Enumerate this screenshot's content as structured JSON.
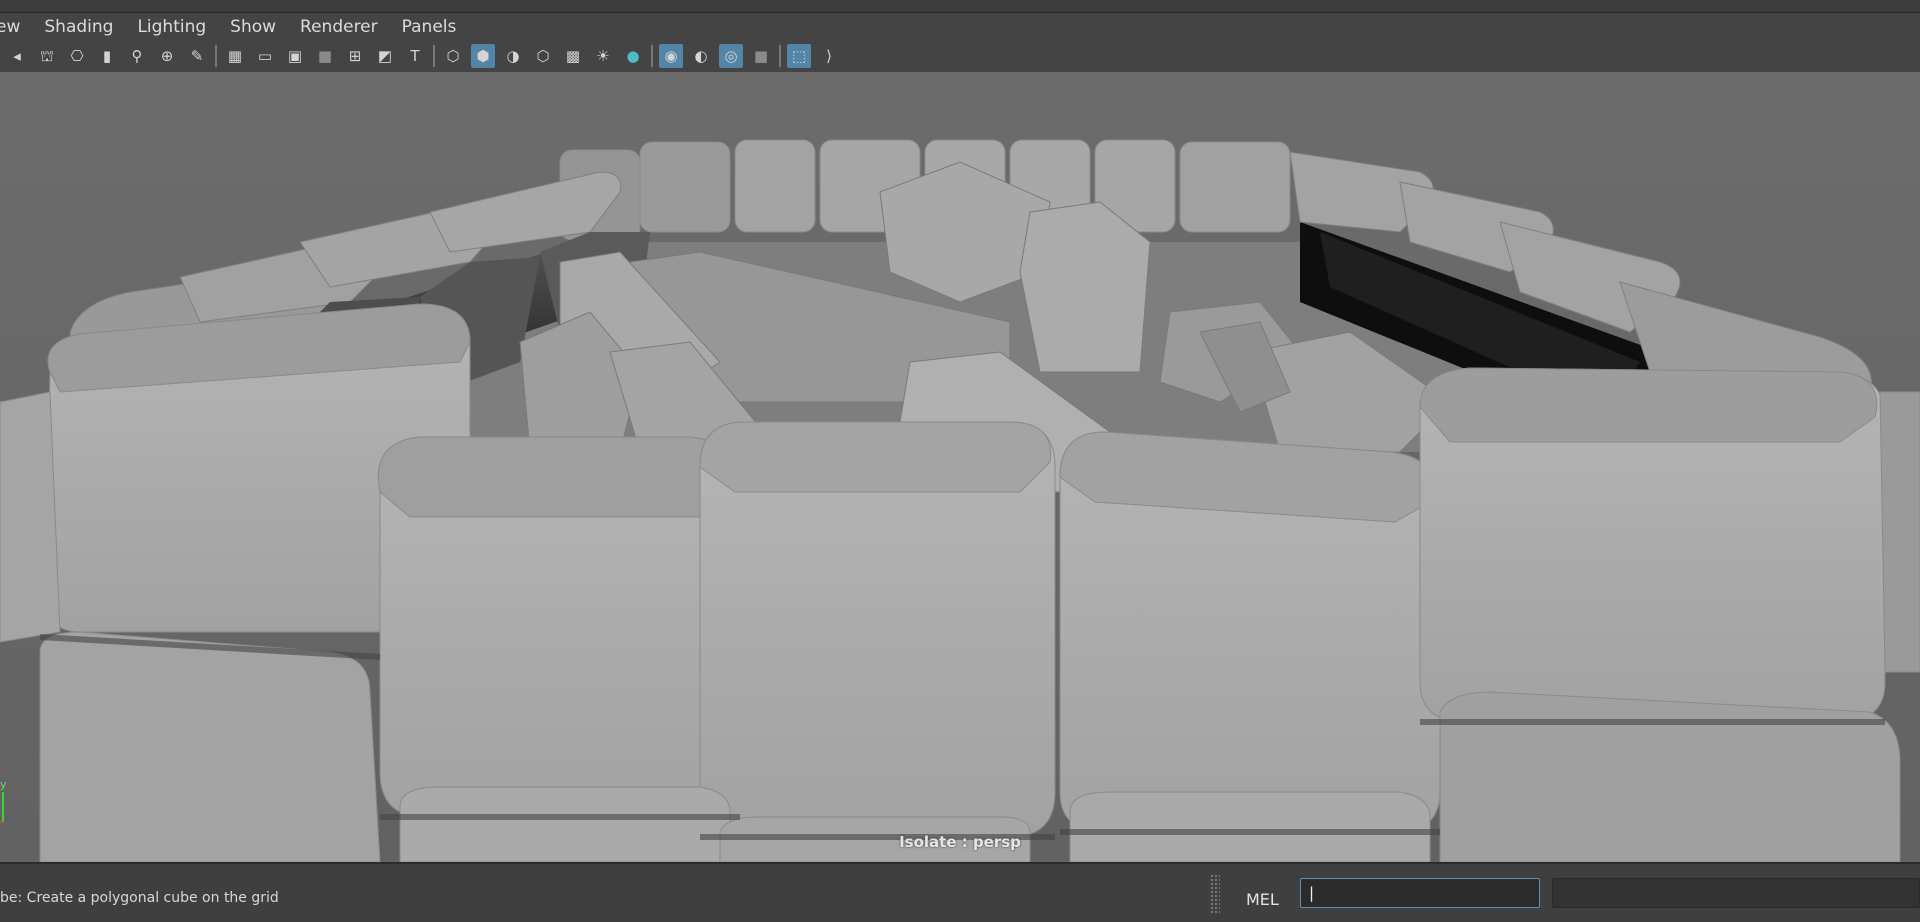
{
  "menubar": {
    "items": [
      "ew",
      "Shading",
      "Lighting",
      "Show",
      "Renderer",
      "Panels"
    ]
  },
  "toolbar": {
    "groups": [
      [
        "camera-previous-icon",
        "camera-lock-icon",
        "camera-attributes-icon",
        "bookmark-icon",
        "image-plane-icon",
        "zoom-camera-icon",
        "grease-pencil-icon"
      ],
      [
        "grid-icon",
        "film-gate-icon",
        "resolution-gate-icon",
        "gate-mask-icon",
        "field-chart-icon",
        "safe-action-icon",
        "safe-title-icon"
      ],
      [
        "wireframe-icon",
        "smooth-shade-icon",
        "wireframe-on-shaded-icon",
        "default-material-icon",
        "textured-icon",
        "use-lights-icon",
        "shadows-icon"
      ],
      [
        "screen-space-ao-icon",
        "motion-blur-icon",
        "multisample-aa-icon",
        "depth-of-field-icon"
      ],
      [
        "isolate-select-icon",
        "xray-icon"
      ]
    ],
    "active": [
      "smooth-shade-icon",
      "screen-space-ao-icon",
      "multisample-aa-icon",
      "isolate-select-icon"
    ],
    "accent_color": "#5285a6"
  },
  "viewport": {
    "isolate_label": "Isolate : persp",
    "axis_label": "y",
    "background_color": "#6b6b6b"
  },
  "statusbar": {
    "help_text": "be: Create a polygonal cube on the grid",
    "mel_label": "MEL",
    "mel_value": "|"
  }
}
